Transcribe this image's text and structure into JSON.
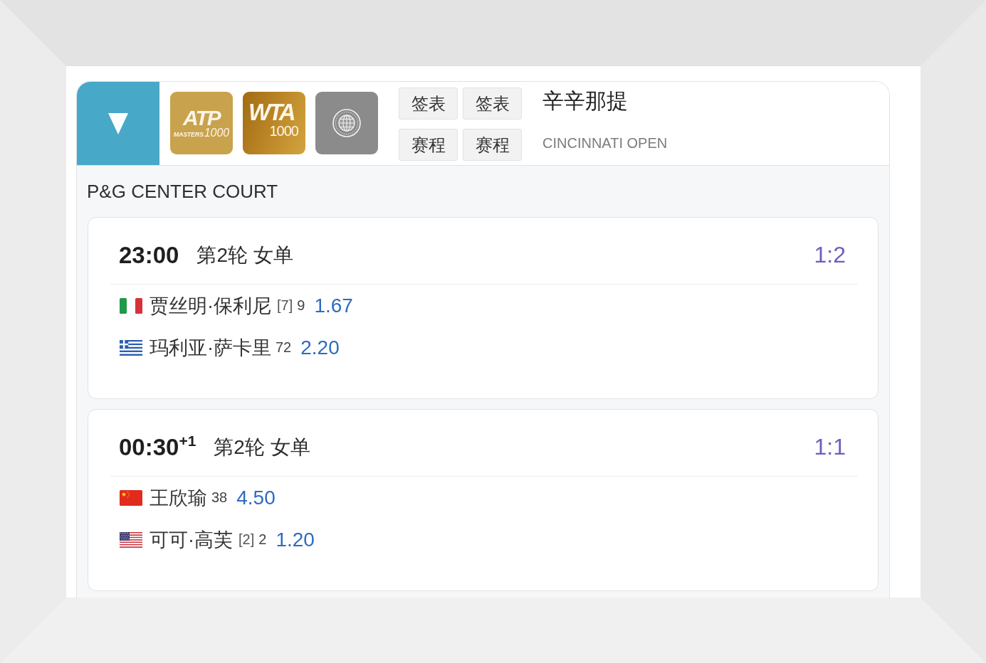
{
  "header": {
    "logos": [
      {
        "kind": "atp",
        "title": "ATP",
        "caption": "MASTERS",
        "number": "1000"
      },
      {
        "kind": "wta",
        "title": "WTA",
        "number": "1000"
      },
      {
        "kind": "emblem"
      }
    ],
    "buttons": [
      {
        "label": "签表"
      },
      {
        "label": "签表"
      },
      {
        "label": "赛程"
      },
      {
        "label": "赛程"
      }
    ],
    "tournament": {
      "name": "辛辛那提",
      "subtitle": "CINCINNATI OPEN"
    }
  },
  "court": "P&G CENTER COURT",
  "matches": [
    {
      "time": "23:00",
      "round": "第2轮 女单",
      "score": "1:2",
      "players": [
        {
          "kind": "italy",
          "name": "贾丝明·保利尼",
          "seed": "[7]",
          "rank": "9",
          "odds": "1.67"
        },
        {
          "kind": "greece",
          "name": "玛利亚·萨卡里",
          "rank": "72",
          "odds": "2.20"
        }
      ]
    },
    {
      "time": "00:30$^{+1}$",
      "round": "第2轮 女单",
      "score": "1:1",
      "players": [
        {
          "kind": "china",
          "name": "王欣瑜",
          "rank": "38",
          "odds": "4.50"
        },
        {
          "kind": "usa",
          "name": "可可·高芙",
          "seed": "[2]",
          "rank": "2",
          "odds": "1.20"
        }
      ]
    }
  ]
}
